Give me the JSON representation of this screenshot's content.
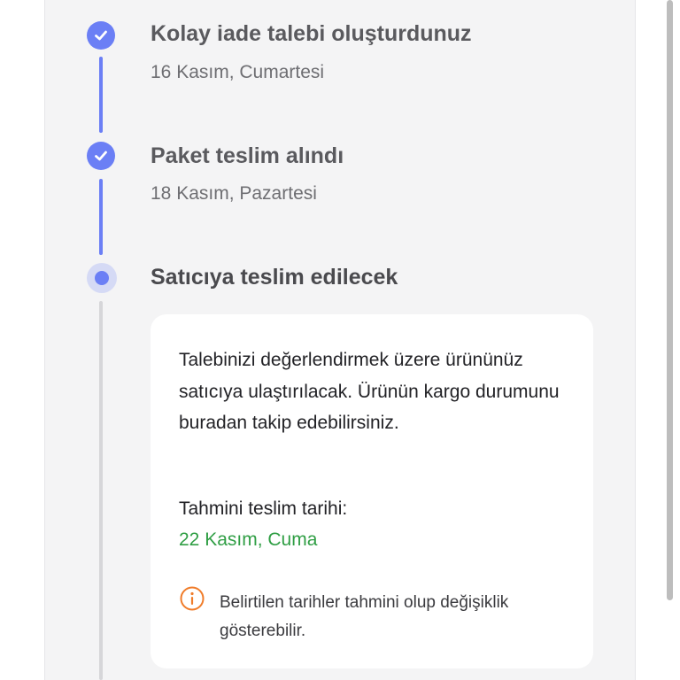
{
  "timeline": {
    "steps": [
      {
        "title": "Kolay iade talebi oluşturdunuz",
        "date": "16 Kasım, Cumartesi",
        "status": "completed"
      },
      {
        "title": "Paket teslim alındı",
        "date": "18 Kasım, Pazartesi",
        "status": "completed"
      },
      {
        "title": "Satıcıya teslim edilecek",
        "status": "current"
      }
    ]
  },
  "detail_card": {
    "description": "Talebinizi değerlendirmek üzere ürününüz satıcıya ulaştırılacak. Ürünün kargo durumunu buradan takip edebilirsiniz.",
    "estimated_label": "Tahmini teslim tarihi:",
    "estimated_date": "22 Kasım, Cuma",
    "info_note": "Belirtilen tarihler tahmini olup değişiklik gösterebilir."
  },
  "colors": {
    "accent": "#6b7ff5",
    "success": "#2f9e44",
    "info": "#f07c2a",
    "pending_line": "#d6d6d9"
  },
  "icons": {
    "completed": "check-circle-icon",
    "current": "current-dot-icon",
    "info": "info-circle-icon"
  }
}
